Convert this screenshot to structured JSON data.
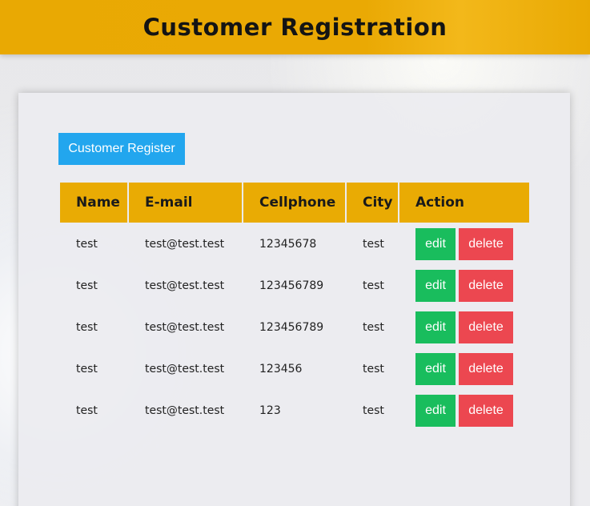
{
  "header": {
    "title": "Customer Registration"
  },
  "toolbar": {
    "register_label": "Customer Register"
  },
  "table": {
    "columns": [
      "Name",
      "E-mail",
      "Cellphone",
      "City",
      "Action"
    ],
    "rows": [
      {
        "name": "test",
        "email": "test@test.test",
        "cellphone": "12345678",
        "city": "test"
      },
      {
        "name": "test",
        "email": "test@test.test",
        "cellphone": "123456789",
        "city": "test"
      },
      {
        "name": "test",
        "email": "test@test.test",
        "cellphone": "123456789",
        "city": "test"
      },
      {
        "name": "test",
        "email": "test@test.test",
        "cellphone": "123456",
        "city": "test"
      },
      {
        "name": "test",
        "email": "test@test.test",
        "cellphone": "123",
        "city": "test"
      }
    ],
    "edit_label": "edit",
    "delete_label": "delete"
  },
  "colors": {
    "header_bg": "#e9a903",
    "register_button": "#22a6ee",
    "edit_button": "#19bd5d",
    "delete_button": "#ec4750"
  }
}
